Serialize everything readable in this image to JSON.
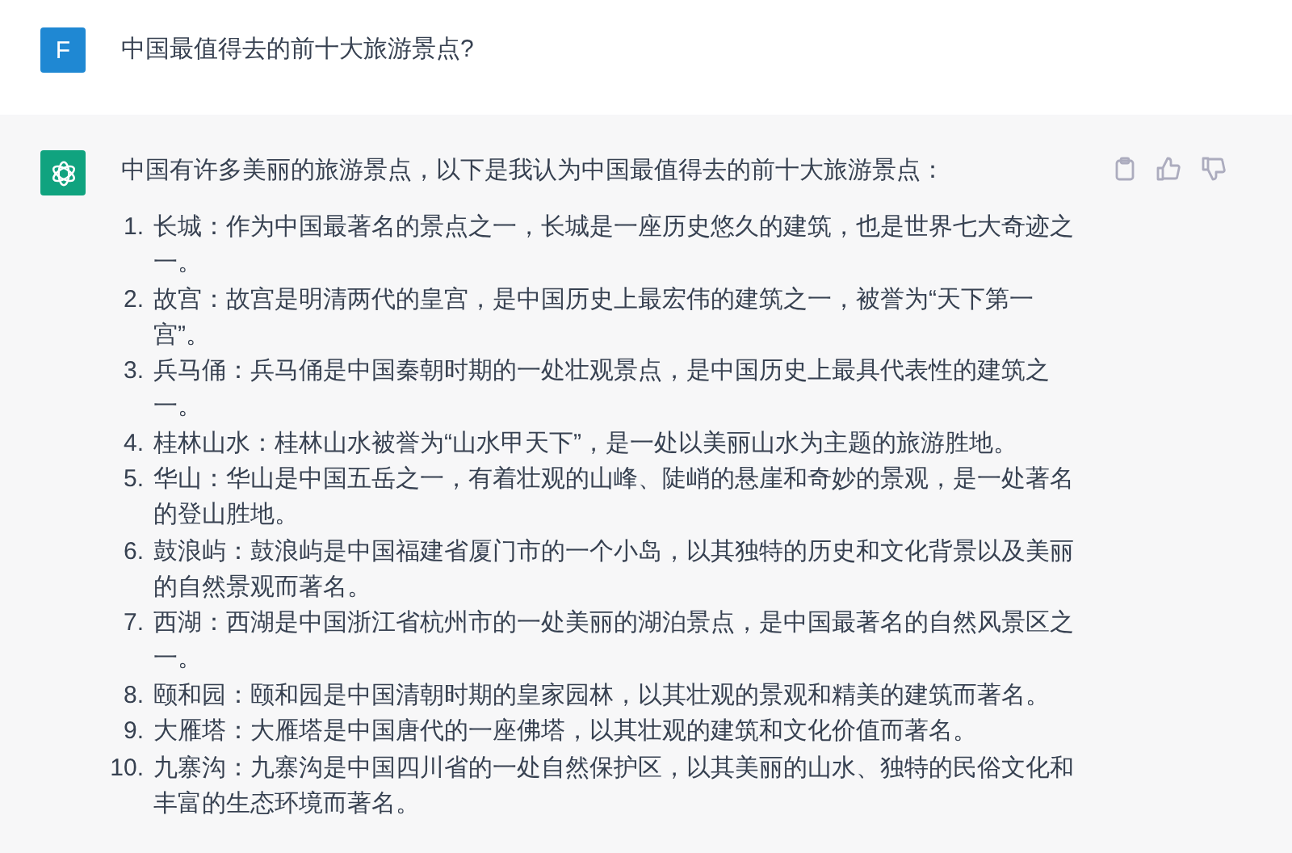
{
  "messages": [
    {
      "kind": "user",
      "avatar": "F",
      "text": "中国最值得去的前十大旅游景点?"
    },
    {
      "kind": "assistant",
      "text": "中国有许多美丽的旅游景点，以下是我认为中国最值得去的前十大旅游景点：",
      "list": [
        {
          "number": "1.",
          "text": "长城：作为中国最著名的景点之一，长城是一座历史悠久的建筑，也是世界七大奇迹之一。"
        },
        {
          "number": "2.",
          "text": "故宫：故宫是明清两代的皇宫，是中国历史上最宏伟的建筑之一，被誉为“天下第一宫”。"
        },
        {
          "number": "3.",
          "text": "兵马俑：兵马俑是中国秦朝时期的一处壮观景点，是中国历史上最具代表性的建筑之一。"
        },
        {
          "number": "4.",
          "text": "桂林山水：桂林山水被誉为“山水甲天下”，是一处以美丽山水为主题的旅游胜地。"
        },
        {
          "number": "5.",
          "text": "华山：华山是中国五岳之一，有着壮观的山峰、陡峭的悬崖和奇妙的景观，是一处著名的登山胜地。"
        },
        {
          "number": "6.",
          "text": "鼓浪屿：鼓浪屿是中国福建省厦门市的一个小岛，以其独特的历史和文化背景以及美丽的自然景观而著名。"
        },
        {
          "number": "7.",
          "text": "西湖：西湖是中国浙江省杭州市的一处美丽的湖泊景点，是中国最著名的自然风景区之一。"
        },
        {
          "number": "8.",
          "text": "颐和园：颐和园是中国清朝时期的皇家园林，以其壮观的景观和精美的建筑而著名。"
        },
        {
          "number": "9.",
          "text": "大雁塔：大雁塔是中国唐代的一座佛塔，以其壮观的建筑和文化价值而著名。"
        },
        {
          "number": "10.",
          "text": "九寨沟：九寨沟是中国四川省的一处自然保护区，以其美丽的山水、独特的民俗文化和丰富的生态环境而著名。"
        }
      ]
    }
  ]
}
